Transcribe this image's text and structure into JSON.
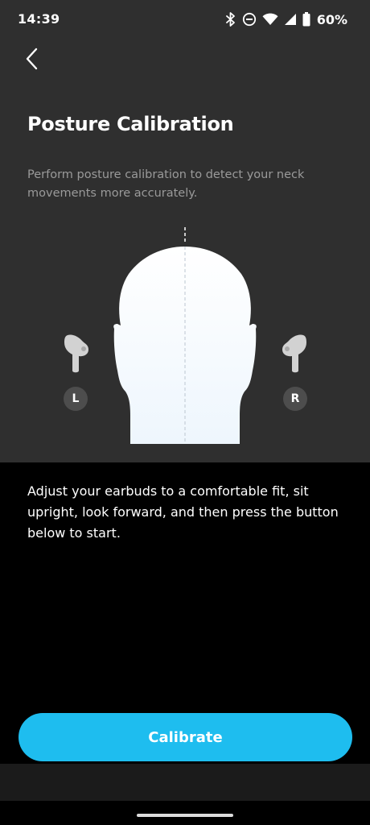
{
  "status_bar": {
    "time": "14:39",
    "battery": "60%",
    "icons": [
      "bluetooth-icon",
      "do-not-disturb-icon",
      "wifi-icon",
      "signal-icon",
      "battery-icon"
    ]
  },
  "header": {
    "back_icon": "chevron-left-icon",
    "title": "Posture Calibration"
  },
  "description": "Perform posture calibration to detect your neck movements more accurately.",
  "illustration": {
    "left_label": "L",
    "right_label": "R",
    "icons": [
      "head-silhouette",
      "left-earbud-icon",
      "right-earbud-icon"
    ]
  },
  "instructions": "Adjust your earbuds to a comfortable fit, sit upright, look forward, and then press the button below to start.",
  "calibrate_button": {
    "label": "Calibrate"
  },
  "colors": {
    "panel": "#2f2f2f",
    "background": "#000000",
    "accent": "#1ebdef",
    "badge": "#4d4d4d"
  }
}
